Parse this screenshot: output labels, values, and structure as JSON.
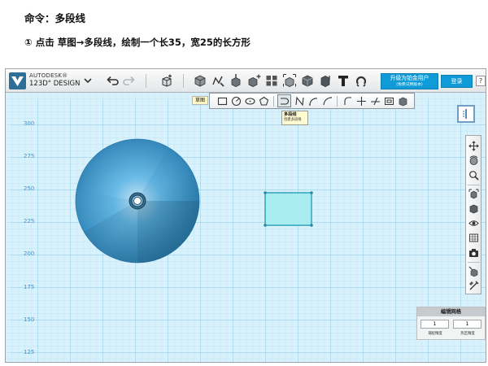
{
  "document": {
    "title": "命令：多段线",
    "step": "①  点击  草图→多段线，绘制一个长35，宽25的长方形"
  },
  "app": {
    "brand_line1": "AUTODESK®",
    "brand_line2": "123D° DESIGN",
    "upgrade_line1": "升级为铂金用户",
    "upgrade_line2": "(免费试用版本)",
    "login_label": "登录",
    "help_label": "?"
  },
  "toolbar": {
    "icons": [
      "undo-icon",
      "redo-icon",
      "add-primitive-icon",
      "primitives-icon",
      "sketch-icon",
      "construct-icon",
      "modify-icon",
      "pattern-icon",
      "grouping-icon",
      "combine-icon",
      "measure-icon",
      "text-icon",
      "snap-icon"
    ]
  },
  "sketch": {
    "label": "草图",
    "tools": [
      "sketch-rectangle-icon",
      "sketch-circle-icon",
      "sketch-ellipse-icon",
      "sketch-polygon-icon",
      "sketch-polyline-icon",
      "sketch-spline-icon",
      "sketch-two-point-arc-icon",
      "sketch-three-point-arc-icon",
      "sketch-fillet-icon",
      "sketch-trim-icon",
      "sketch-extend-icon",
      "sketch-offset-icon",
      "sketch-project-icon"
    ],
    "active_tool": "sketch-polyline-icon",
    "tooltip_title": "多段线",
    "tooltip_desc": "创建多段线"
  },
  "axis_labels": [
    "300",
    "275",
    "250",
    "225",
    "200",
    "175",
    "150",
    "125"
  ],
  "grid_panel": {
    "title": "编辑网格",
    "snap_value": "1",
    "grid_value": "1",
    "snap_caption": "捕捉精度",
    "grid_caption": "热区精度"
  },
  "colors": {
    "accent": "#0f9bd7",
    "grid_background": "#d6eff9",
    "sketch_fill": "#a8ecf0",
    "sketch_stroke": "#3aa9bf",
    "cone": "#3a8fc4"
  }
}
